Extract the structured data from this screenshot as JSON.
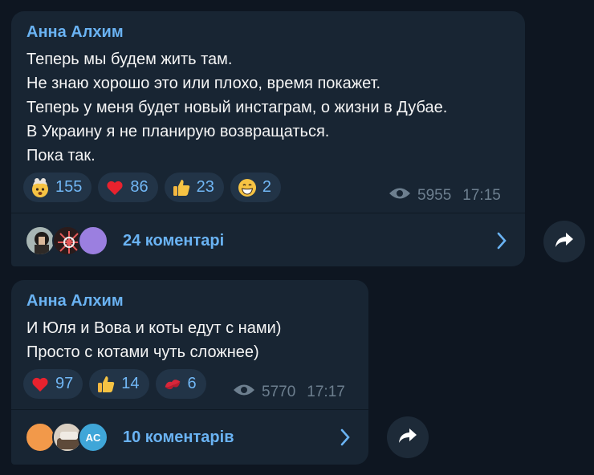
{
  "messages": [
    {
      "author": "Анна Алхим",
      "lines": [
        "Теперь мы будем жить там.",
        "Не знаю хорошо это или плохо, время покажет.",
        "Теперь у меня будет новый инстаграм, о жизни в Дубае.",
        "В Украину я не планирую возвращаться.",
        "Пока так."
      ],
      "reactions": [
        {
          "emoji": "exploding-head",
          "count": "155"
        },
        {
          "emoji": "red-heart",
          "count": "86"
        },
        {
          "emoji": "thumbs-up",
          "count": "23"
        },
        {
          "emoji": "grinning-face",
          "count": "2"
        }
      ],
      "views": "5955",
      "time": "17:15",
      "comments_label": "24 коментарі"
    },
    {
      "author": "Анна Алхим",
      "lines": [
        "И Юля и Вова и коты едут с нами)",
        "Просто с котами чуть сложнее)"
      ],
      "reactions": [
        {
          "emoji": "red-heart",
          "count": "97"
        },
        {
          "emoji": "thumbs-up",
          "count": "14"
        },
        {
          "emoji": "kiss-mark",
          "count": "6"
        }
      ],
      "views": "5770",
      "time": "17:17",
      "comments_label": "10 коментарів",
      "avatar_initials": "AC"
    }
  ],
  "colors": {
    "background": "#0e1621",
    "bubble": "#182533",
    "accent": "#6ab3f3",
    "meta": "#6d7f8f"
  }
}
